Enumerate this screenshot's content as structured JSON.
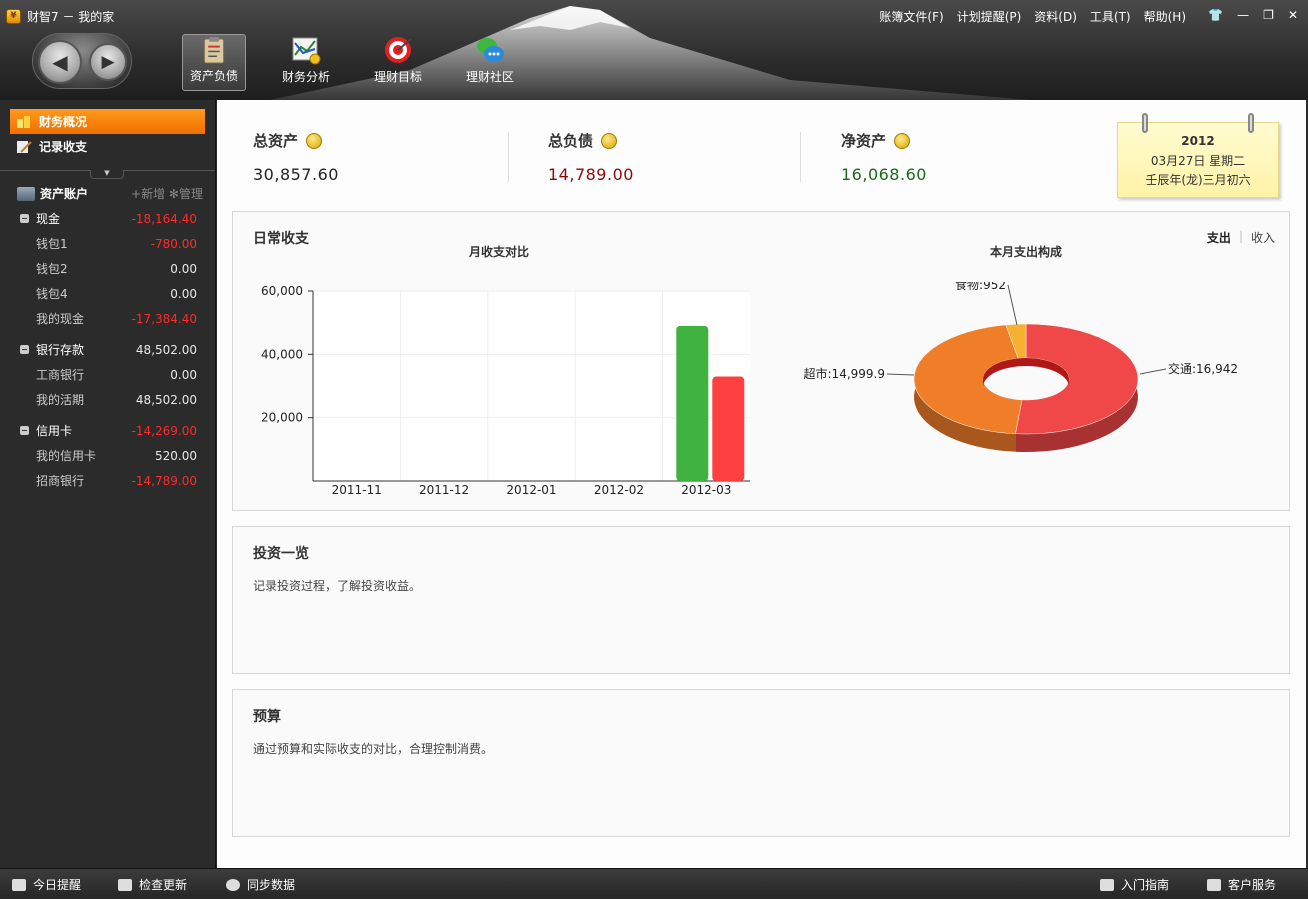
{
  "window": {
    "title": "财智7 － 我的家",
    "menu": [
      "账簿文件(F)",
      "计划提醒(P)",
      "资料(D)",
      "工具(T)",
      "帮助(H)"
    ]
  },
  "toolbar": {
    "items": [
      {
        "label": "资产负债",
        "active": true
      },
      {
        "label": "财务分析",
        "active": false
      },
      {
        "label": "理财目标",
        "active": false
      },
      {
        "label": "理财社区",
        "active": false
      }
    ]
  },
  "sidebar": {
    "nav": [
      {
        "label": "财务概况",
        "active": true
      },
      {
        "label": "记录收支",
        "active": false
      }
    ],
    "accounts_header": "资产账户",
    "add_label": "+新增",
    "manage_label": "管理",
    "groups": [
      {
        "name": "现金",
        "value": "-18,164.40",
        "negative": true,
        "children": [
          {
            "name": "钱包1",
            "value": "-780.00",
            "negative": true
          },
          {
            "name": "钱包2",
            "value": "0.00",
            "negative": false
          },
          {
            "name": "钱包4",
            "value": "0.00",
            "negative": false
          },
          {
            "name": "我的现金",
            "value": "-17,384.40",
            "negative": true
          }
        ]
      },
      {
        "name": "银行存款",
        "value": "48,502.00",
        "negative": false,
        "children": [
          {
            "name": "工商银行",
            "value": "0.00",
            "negative": false
          },
          {
            "name": "我的活期",
            "value": "48,502.00",
            "negative": false
          }
        ]
      },
      {
        "name": "信用卡",
        "value": "-14,269.00",
        "negative": true,
        "children": [
          {
            "name": "我的信用卡",
            "value": "520.00",
            "negative": false
          },
          {
            "name": "招商银行",
            "value": "-14,789.00",
            "negative": true
          }
        ]
      }
    ]
  },
  "summary": {
    "total_assets": {
      "label": "总资产",
      "value": "30,857.60"
    },
    "total_liabilities": {
      "label": "总负债",
      "value": "14,789.00"
    },
    "net_assets": {
      "label": "净资产",
      "value": "16,068.60"
    }
  },
  "calendar": {
    "year": "2012",
    "date_line": "03月27日 星期二",
    "lunar_line": "壬辰年(龙)三月初六"
  },
  "daily": {
    "title": "日常收支",
    "tab_expense": "支出",
    "tab_income": "收入",
    "bar_title": "月收支对比",
    "pie_title": "本月支出构成"
  },
  "chart_data": [
    {
      "type": "bar",
      "title": "月收支对比",
      "categories": [
        "2011-11",
        "2011-12",
        "2012-01",
        "2012-02",
        "2012-03"
      ],
      "series": [
        {
          "values": [
            0,
            0,
            0,
            0,
            49000
          ],
          "color": "#3fb23f"
        },
        {
          "values": [
            0,
            0,
            0,
            0,
            33000
          ],
          "color": "#ff4040"
        }
      ],
      "ylim": [
        0,
        60000
      ],
      "yticks": [
        "20,000",
        "40,000",
        "60,000"
      ],
      "ytick_values": [
        20000,
        40000,
        60000
      ],
      "grid": true
    },
    {
      "type": "pie",
      "title": "本月支出构成",
      "donut": true,
      "slices": [
        {
          "label": "交通:16,942",
          "value": 16942,
          "color": "#f04848"
        },
        {
          "label": "超市:14,999.9",
          "value": 14999.9,
          "color": "#f07e28"
        },
        {
          "label": "食物:952",
          "value": 952,
          "color": "#f8b030"
        }
      ]
    }
  ],
  "investment": {
    "title": "投资一览",
    "desc": "记录投资过程，了解投资收益。"
  },
  "budget": {
    "title": "预算",
    "desc": "通过预算和实际收支的对比，合理控制消费。"
  },
  "statusbar": {
    "left": [
      "今日提醒",
      "检查更新",
      "同步数据"
    ],
    "right": [
      "入门指南",
      "客户服务"
    ]
  }
}
